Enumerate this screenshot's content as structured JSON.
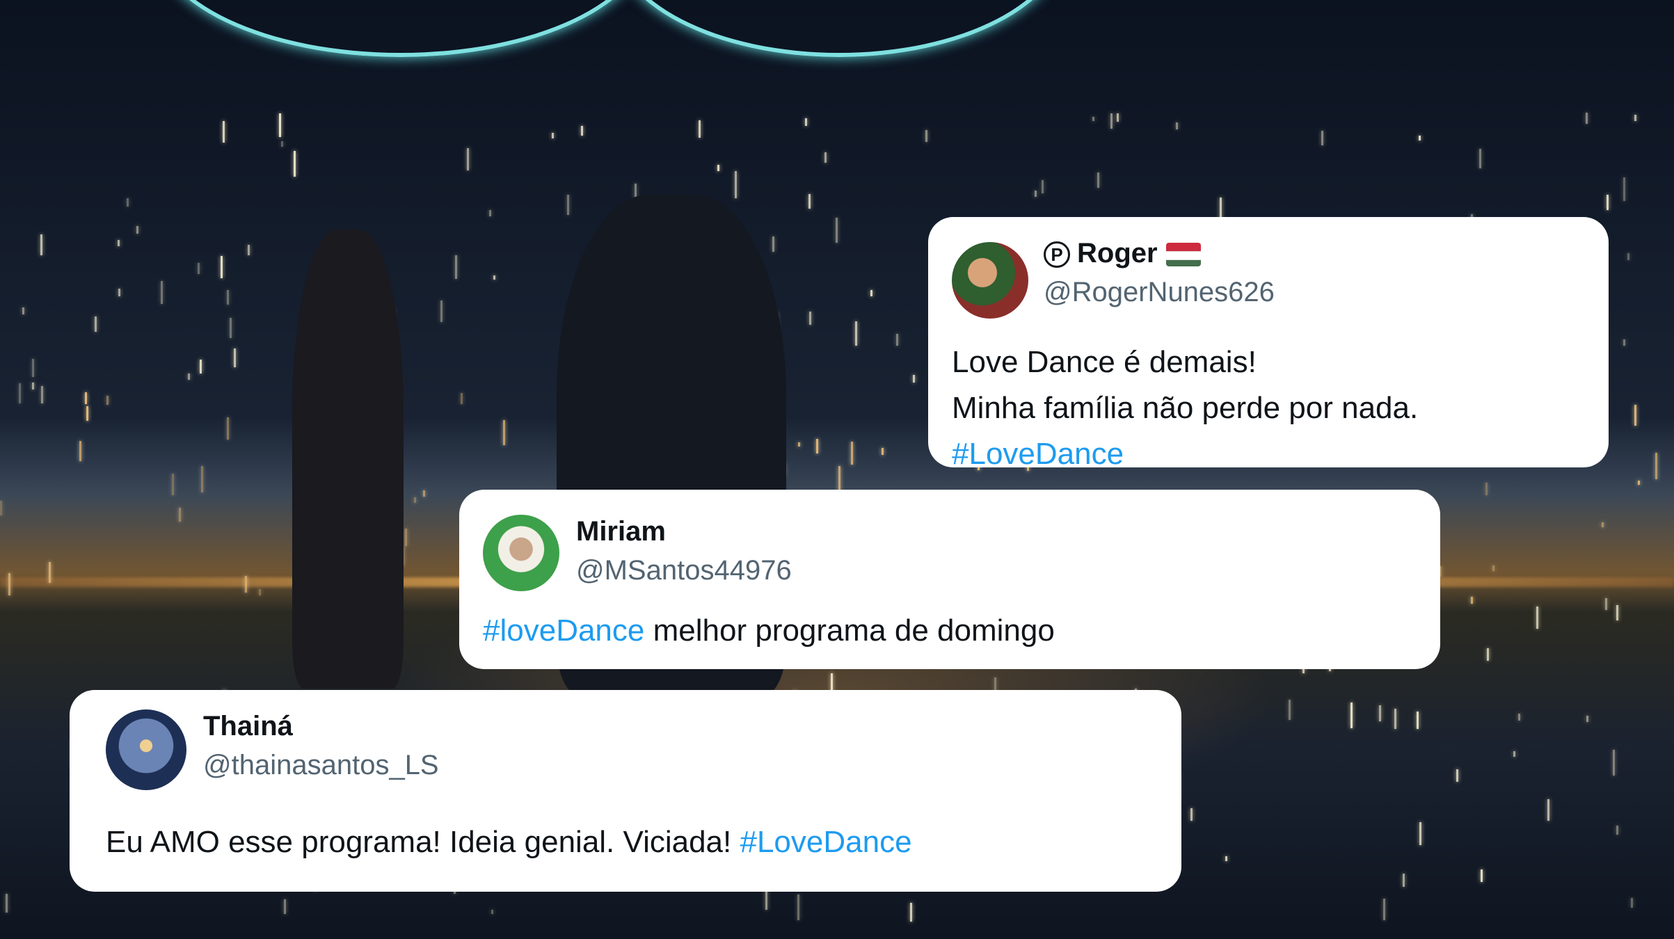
{
  "tweets": [
    {
      "name": "Roger",
      "handle": "@RogerNunes626",
      "lines": [
        "Love Dance é demais!",
        "Minha família não perde por nada."
      ],
      "hashtag": "#LoveDance",
      "badge_icon": "p-badge-icon",
      "flag_colors": [
        "#cd2a3e",
        "#ffffff",
        "#436f4d"
      ]
    },
    {
      "name": "Miriam",
      "handle": "@MSantos44976",
      "hashtag": "#loveDance",
      "text": " melhor programa de domingo"
    },
    {
      "name": "Thainá",
      "handle": "@thainasantos_LS",
      "text": "Eu AMO esse programa! Ideia genial. Viciada! ",
      "hashtag": "#LoveDance"
    }
  ],
  "colors": {
    "hashtag": "#1d9bf0",
    "handle": "#536471",
    "card": "#ffffff"
  }
}
